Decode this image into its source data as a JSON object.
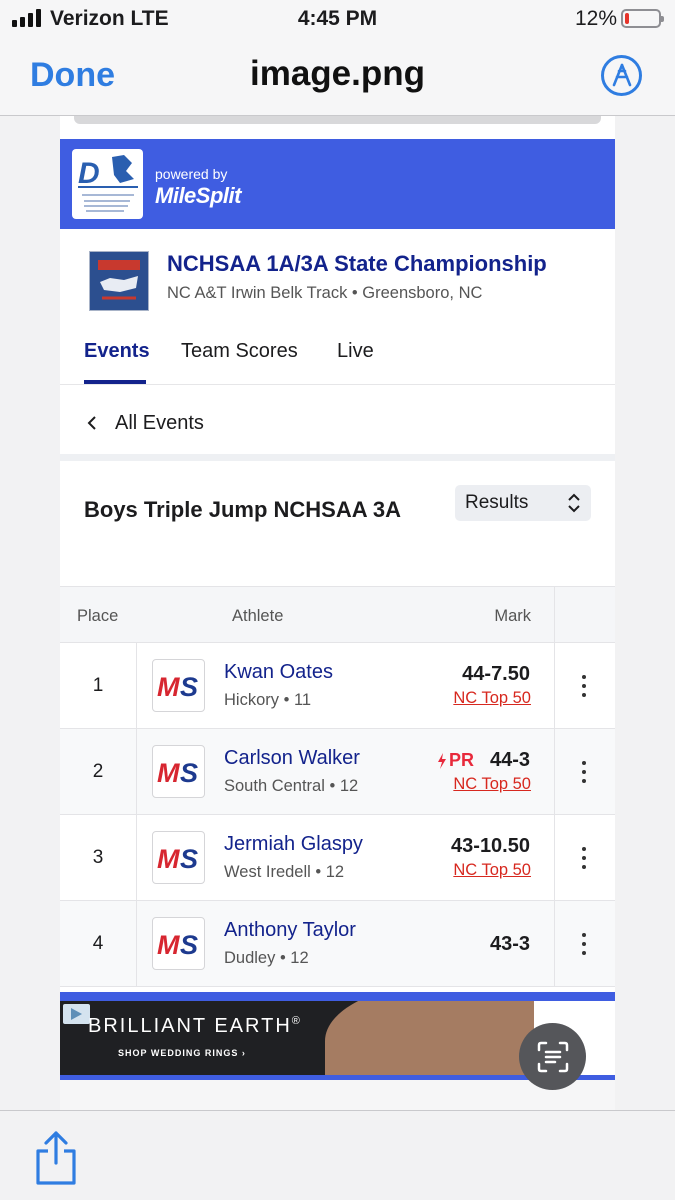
{
  "status_bar": {
    "carrier": "Verizon LTE",
    "time": "4:45 PM",
    "battery_pct": "12%",
    "battery_level": 0.12
  },
  "viewer": {
    "done_label": "Done",
    "title": "image.png",
    "markup_icon": "markup-pen-icon",
    "share_icon": "share-icon",
    "live_text_icon": "live-text-icon"
  },
  "banner": {
    "powered_by": "powered by",
    "brand": "MileSplit",
    "logo": "durham-striders-logo"
  },
  "meet": {
    "title": "NCHSAA 1A/3A State Championship",
    "venue": "NC A&T Irwin Belk Track • Greensboro, NC"
  },
  "tabs": [
    {
      "label": "Events",
      "active": true
    },
    {
      "label": "Team Scores",
      "active": false
    },
    {
      "label": "Live",
      "active": false
    }
  ],
  "nav": {
    "back_label": "All Events"
  },
  "event": {
    "title": "Boys Triple Jump NCHSAA 3A",
    "view_select": "Results"
  },
  "table": {
    "headers": {
      "place": "Place",
      "athlete": "Athlete",
      "mark": "Mark"
    },
    "rows": [
      {
        "place": "1",
        "name": "Kwan Oates",
        "sub": "Hickory • 11",
        "mark": "44-7.50",
        "pr": "",
        "ranking": "NC Top 50"
      },
      {
        "place": "2",
        "name": "Carlson Walker",
        "sub": "South Central • 12",
        "mark": "44-3",
        "pr": "PR",
        "ranking": "NC Top 50"
      },
      {
        "place": "3",
        "name": "Jermiah Glaspy",
        "sub": "West Iredell • 12",
        "mark": "43-10.50",
        "pr": "",
        "ranking": "NC Top 50"
      },
      {
        "place": "4",
        "name": "Anthony Taylor",
        "sub": "Dudley • 12",
        "mark": "43-3",
        "pr": "",
        "ranking": ""
      }
    ]
  },
  "ad": {
    "brand": "BRILLIANT EARTH",
    "trademark": "®",
    "cta": "SHOP WEDDING RINGS ›"
  },
  "colors": {
    "accent": "#3f5de1",
    "link_navy": "#13238c",
    "ios_blue": "#2f7de1",
    "ranking_red": "#d7281f"
  }
}
